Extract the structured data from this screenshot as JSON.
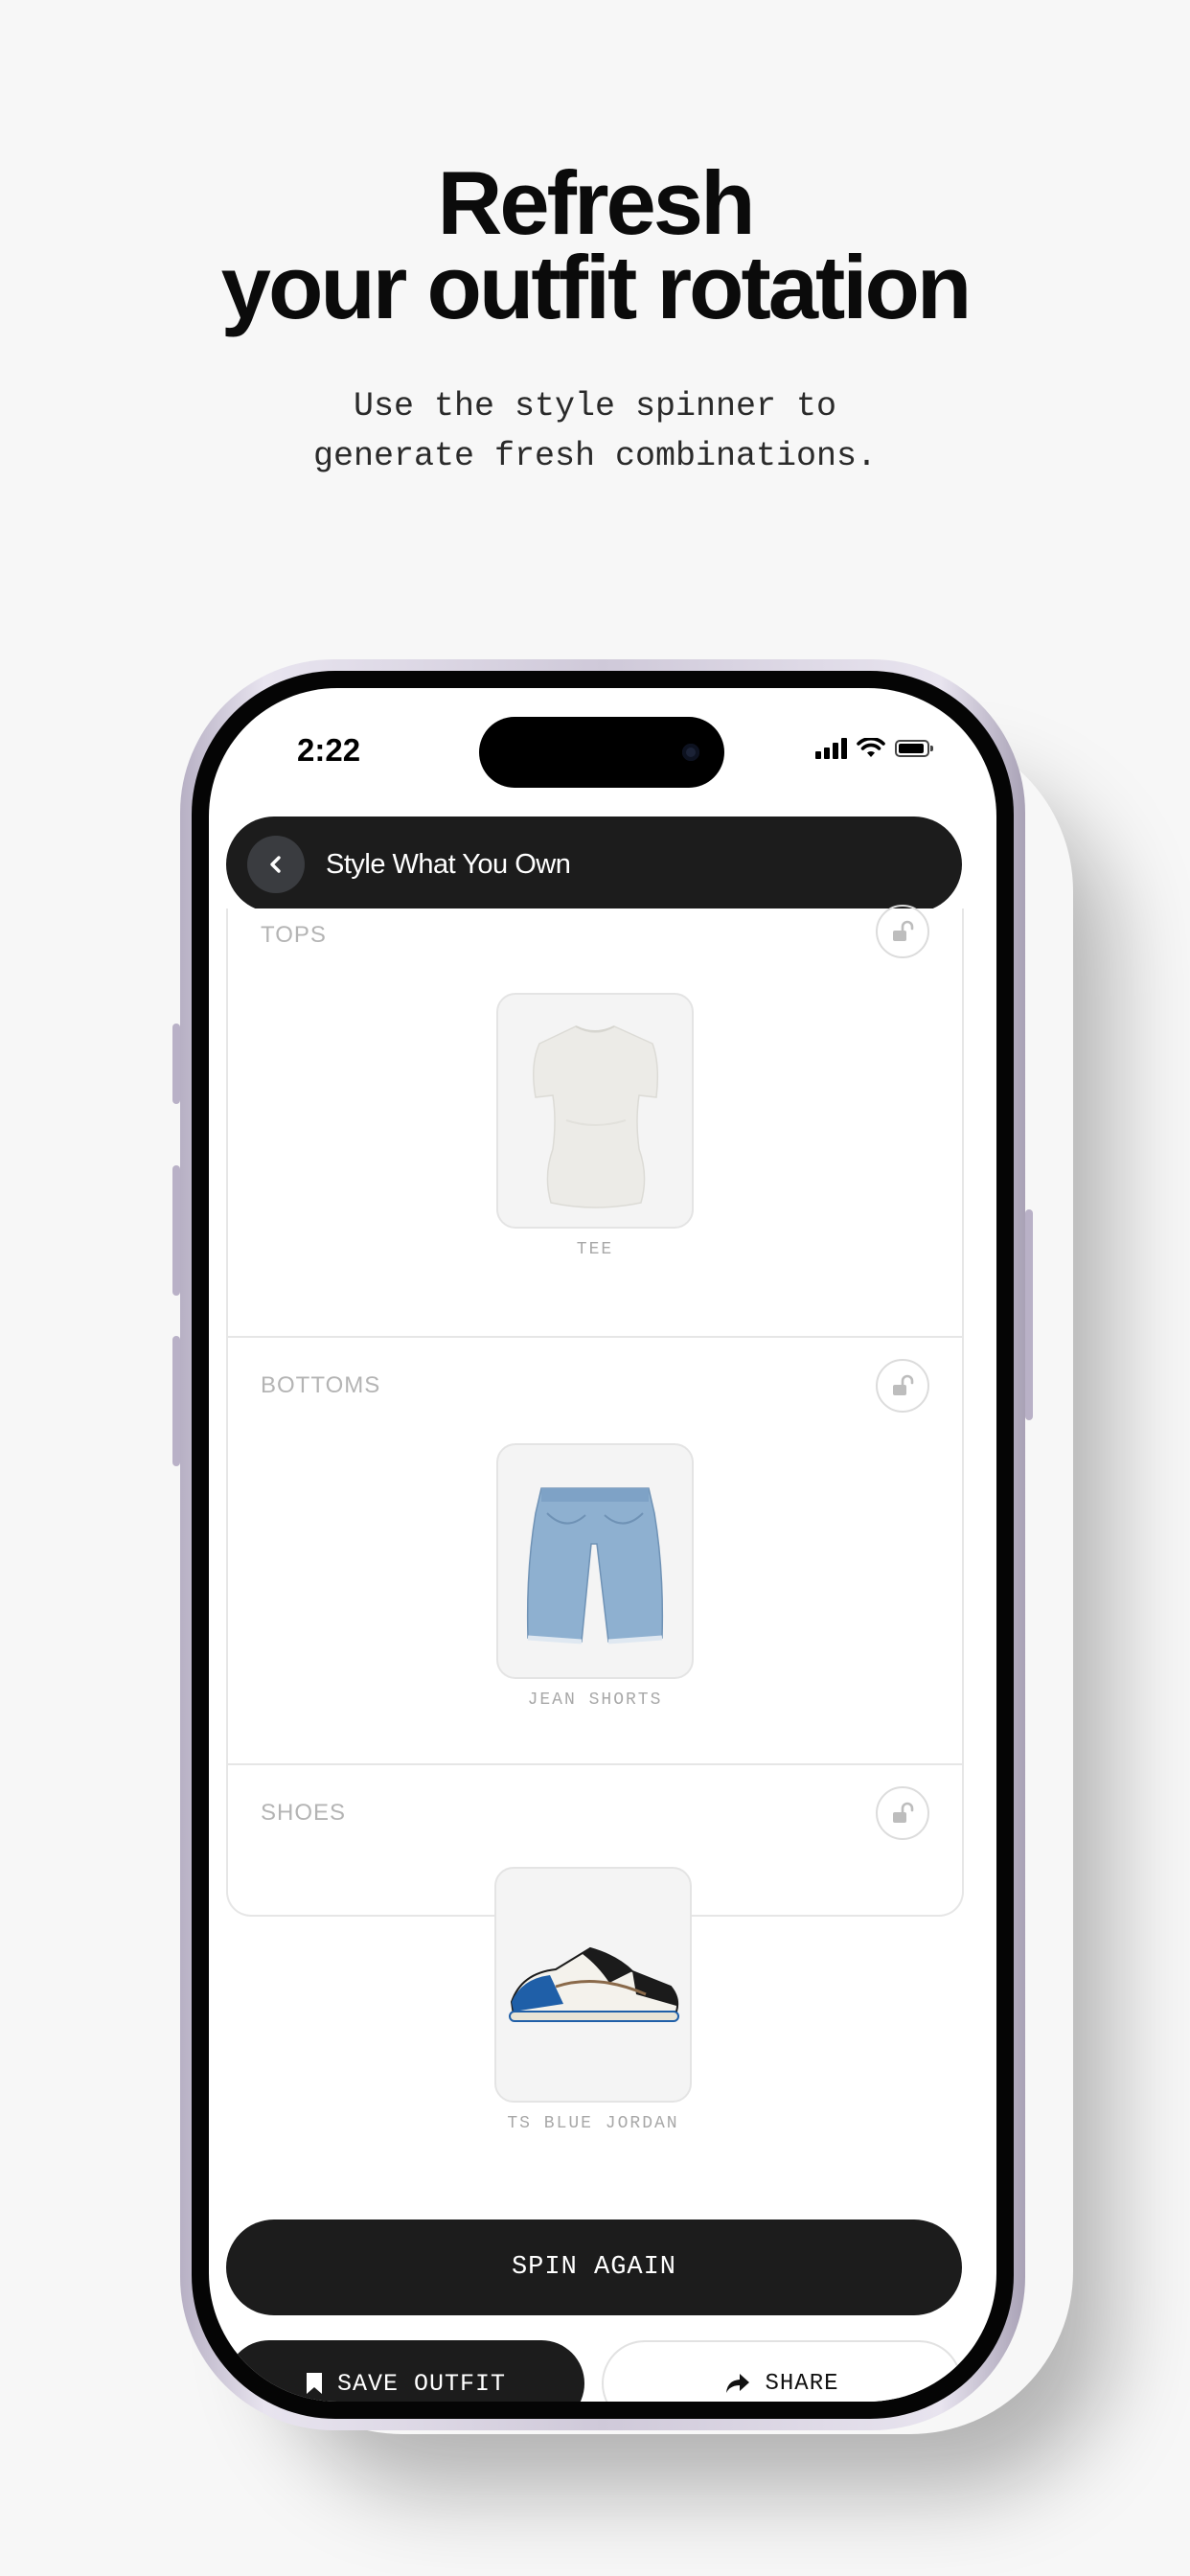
{
  "marketing": {
    "headline_line1": "Refresh",
    "headline_line2": "your outfit rotation",
    "subhead_line1": "Use the style spinner to",
    "subhead_line2": "generate fresh combinations."
  },
  "status_bar": {
    "time": "2:22"
  },
  "header": {
    "title": "Style What You Own",
    "back_icon": "chevron-left-icon"
  },
  "sections": [
    {
      "label": "TOPS",
      "item_name": "TEE",
      "lock_icon": "unlocked-padlock-icon"
    },
    {
      "label": "BOTTOMS",
      "item_name": "JEAN SHORTS",
      "lock_icon": "unlocked-padlock-icon"
    },
    {
      "label": "SHOES",
      "item_name": "TS BLUE JORDAN",
      "lock_icon": "unlocked-padlock-icon"
    }
  ],
  "actions": {
    "spin_label": "SPIN AGAIN",
    "save_label": "SAVE OUTFIT",
    "save_icon": "bookmark-icon",
    "share_label": "SHARE",
    "share_icon": "share-arrow-icon"
  },
  "colors": {
    "background": "#f7f7f7",
    "dark": "#1c1c1c",
    "muted_text": "#b4b4b4"
  }
}
